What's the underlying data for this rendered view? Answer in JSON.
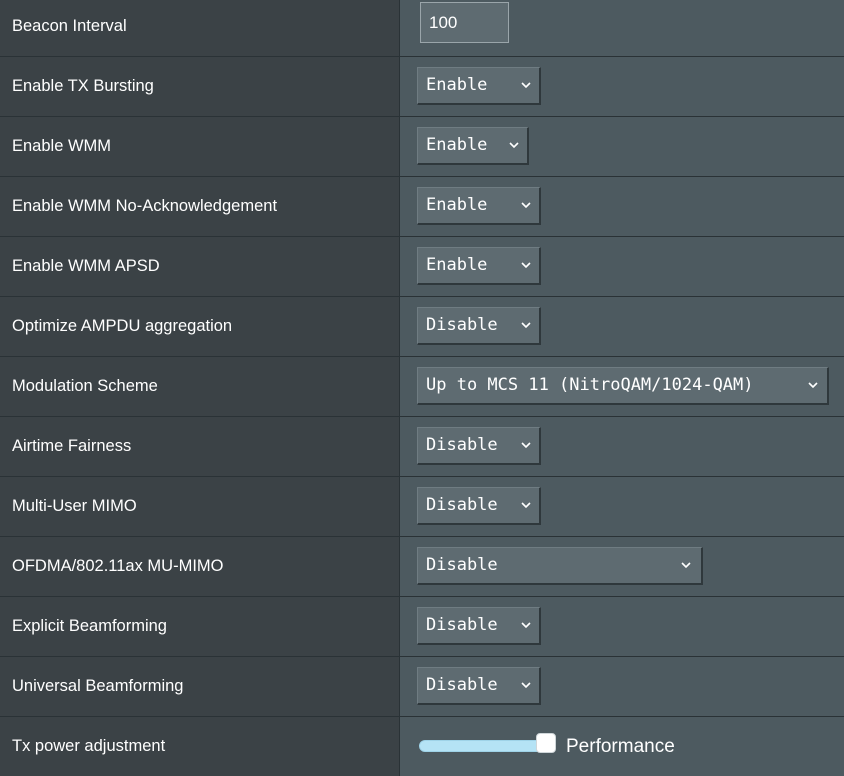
{
  "settings": [
    {
      "label": "Beacon Interval",
      "type": "text",
      "value": "100"
    },
    {
      "label": "Enable TX Bursting",
      "type": "select",
      "value": "Enable"
    },
    {
      "label": "Enable WMM",
      "type": "select",
      "value": "Enable"
    },
    {
      "label": "Enable WMM No-Acknowledgement",
      "type": "select",
      "value": "Enable"
    },
    {
      "label": "Enable WMM APSD",
      "type": "select",
      "value": "Enable"
    },
    {
      "label": "Optimize AMPDU aggregation",
      "type": "select",
      "value": "Disable"
    },
    {
      "label": "Modulation Scheme",
      "type": "select",
      "value": "Up to MCS 11 (NitroQAM/1024-QAM)"
    },
    {
      "label": "Airtime Fairness",
      "type": "select",
      "value": "Disable"
    },
    {
      "label": "Multi-User MIMO",
      "type": "select",
      "value": "Disable"
    },
    {
      "label": "OFDMA/802.11ax MU-MIMO",
      "type": "select",
      "value": "Disable"
    },
    {
      "label": "Explicit Beamforming",
      "type": "select",
      "value": "Disable"
    },
    {
      "label": "Universal Beamforming",
      "type": "select",
      "value": "Disable"
    },
    {
      "label": "Tx power adjustment",
      "type": "slider",
      "value_label": "Performance",
      "level": 1.0
    }
  ],
  "icons": {
    "dropdown": "chevron-down-icon"
  },
  "colors": {
    "label_bg": "#3b4246",
    "value_bg": "#4d5a60",
    "control_bg": "#5e6b71",
    "slider_fill": "#b5e3f5"
  }
}
